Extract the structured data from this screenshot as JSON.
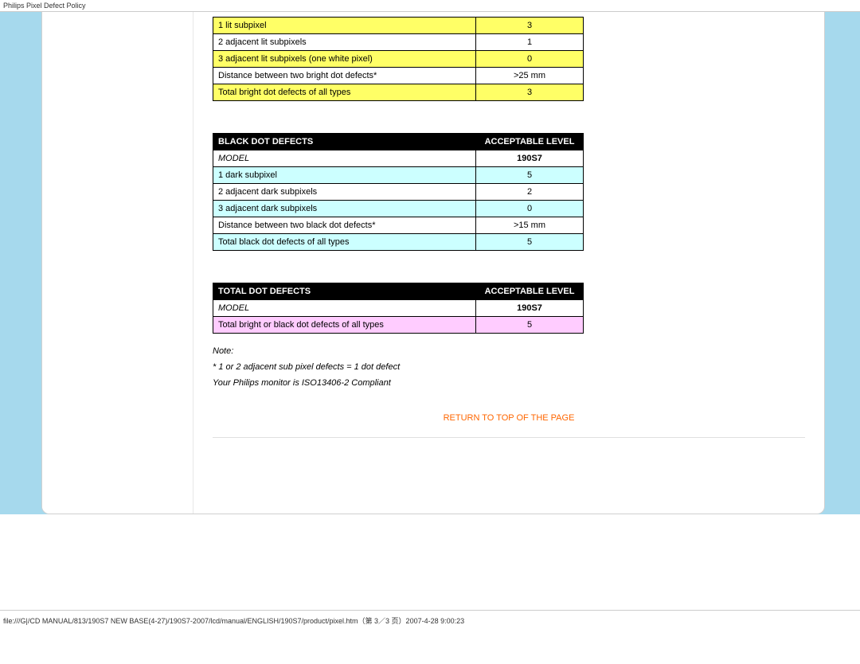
{
  "header_title": "Philips Pixel Defect Policy",
  "footer_text": "file:///G|/CD MANUAL/813/190S7 NEW BASE(4-27)/190S7-2007/lcd/manual/ENGLISH/190S7/product/pixel.htm（第 3／3 页）2007-4-28 9:00:23",
  "table_bright": {
    "rows": [
      {
        "label": "1 lit subpixel",
        "value": "3",
        "bg": "yellow"
      },
      {
        "label": "2 adjacent lit subpixels",
        "value": "1",
        "bg": "white"
      },
      {
        "label": "3 adjacent lit subpixels (one white pixel)",
        "value": "0",
        "bg": "yellow"
      },
      {
        "label": "Distance between two bright dot defects*",
        "value": ">25 mm",
        "bg": "white"
      },
      {
        "label": "Total bright dot defects of all types",
        "value": "3",
        "bg": "yellow"
      }
    ]
  },
  "table_black": {
    "head1": "BLACK DOT DEFECTS",
    "head2": "ACCEPTABLE LEVEL",
    "model_label": "MODEL",
    "model_value": "190S7",
    "rows": [
      {
        "label": "1 dark subpixel",
        "value": "5",
        "bg": "cyan"
      },
      {
        "label": "2 adjacent dark subpixels",
        "value": "2",
        "bg": "white"
      },
      {
        "label": "3 adjacent dark subpixels",
        "value": "0",
        "bg": "cyan"
      },
      {
        "label": "Distance between two black dot defects*",
        "value": ">15 mm",
        "bg": "white"
      },
      {
        "label": "Total black dot defects of all types",
        "value": "5",
        "bg": "cyan"
      }
    ]
  },
  "table_total": {
    "head1": "TOTAL DOT DEFECTS",
    "head2": "ACCEPTABLE LEVEL",
    "model_label": "MODEL",
    "model_value": "190S7",
    "rows": [
      {
        "label": "Total bright or black dot defects of all types",
        "value": "5",
        "bg": "pink"
      }
    ]
  },
  "notes": {
    "note_label": "Note:",
    "note1": "* 1 or 2 adjacent sub pixel defects = 1 dot defect",
    "note2": "Your Philips monitor is ISO13406-2 Compliant"
  },
  "return_link": "RETURN TO TOP OF THE PAGE"
}
